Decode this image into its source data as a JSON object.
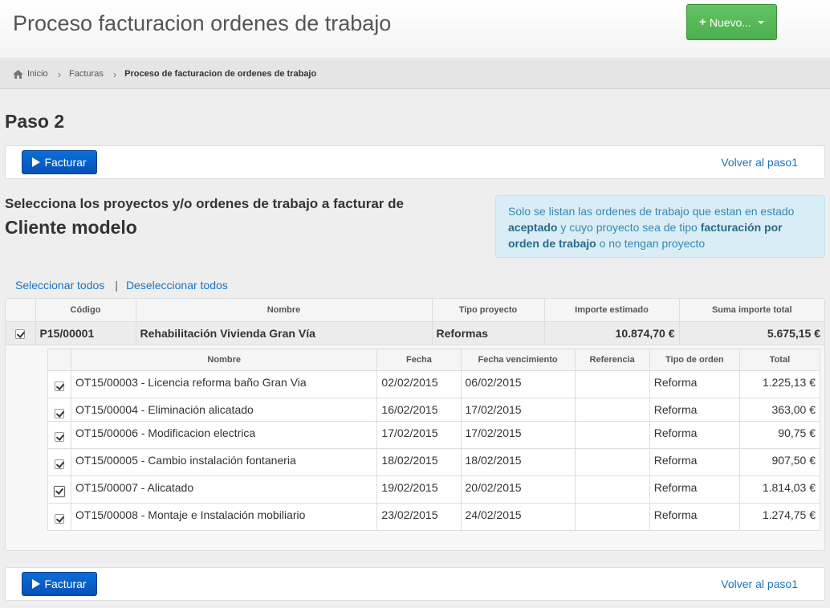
{
  "header": {
    "title": "Proceso facturacion ordenes de trabajo",
    "new_button_label": "Nuevo...",
    "new_button_plus": "+"
  },
  "breadcrumb": {
    "items": [
      "Inicio",
      "Facturas",
      "Proceso de facturacion de ordenes de trabajo"
    ]
  },
  "step_title": "Paso 2",
  "actions": {
    "facturar_label": "Facturar",
    "volver_label": "Volver al paso1"
  },
  "selection": {
    "title": "Selecciona los proyectos y/o ordenes de trabajo a facturar de",
    "client": "Cliente modelo",
    "select_all": "Seleccionar todos",
    "separator": "|",
    "deselect_all": "Deseleccionar todos"
  },
  "info": {
    "part1": "Solo se listan las ordenes de trabajo que estan en estado ",
    "bold1": "aceptado",
    "part2": " y cuyo proyecto sea de tipo ",
    "bold2": "facturación por orden de trabajo",
    "part3": " o no tengan proyecto"
  },
  "project_table": {
    "headers": [
      "Código",
      "Nombre",
      "Tipo proyecto",
      "Importe estimado",
      "Suma importe total"
    ],
    "row": {
      "checked": true,
      "codigo": "P15/00001",
      "nombre": "Rehabilitación Vivienda Gran Vía",
      "tipo": "Reformas",
      "importe_estimado": "10.874,70 €",
      "suma_total": "5.675,15 €"
    }
  },
  "orders_table": {
    "headers": [
      "Nombre",
      "Fecha",
      "Fecha vencimiento",
      "Referencia",
      "Tipo de orden",
      "Total"
    ],
    "rows": [
      {
        "nombre": "OT15/00003 - Licencia reforma baño Gran Via",
        "fecha": "02/02/2015",
        "vencimiento": "06/02/2015",
        "referencia": "",
        "tipo": "Reforma",
        "total": "1.225,13 €"
      },
      {
        "nombre": "OT15/00004 - Eliminación alicatado",
        "fecha": "16/02/2015",
        "vencimiento": "17/02/2015",
        "referencia": "",
        "tipo": "Reforma",
        "total": "363,00 €"
      },
      {
        "nombre": "OT15/00006 - Modificacion electrica",
        "fecha": "17/02/2015",
        "vencimiento": "17/02/2015",
        "referencia": "",
        "tipo": "Reforma",
        "total": "90,75 €"
      },
      {
        "nombre": "OT15/00005 - Cambio instalación fontaneria",
        "fecha": "18/02/2015",
        "vencimiento": "18/02/2015",
        "referencia": "",
        "tipo": "Reforma",
        "total": "907,50 €"
      },
      {
        "nombre": "OT15/00007 - Alicatado",
        "fecha": "19/02/2015",
        "vencimiento": "20/02/2015",
        "referencia": "",
        "tipo": "Reforma",
        "total": "1.814,03 €"
      },
      {
        "nombre": "OT15/00008 - Montaje e Instalación mobiliario",
        "fecha": "23/02/2015",
        "vencimiento": "24/02/2015",
        "referencia": "",
        "tipo": "Reforma",
        "total": "1.274,75 €"
      }
    ]
  },
  "colors": {
    "primary": "#0451b8",
    "success": "#4cae4c",
    "link": "#1a74c0",
    "info_bg": "#d9edf7"
  }
}
